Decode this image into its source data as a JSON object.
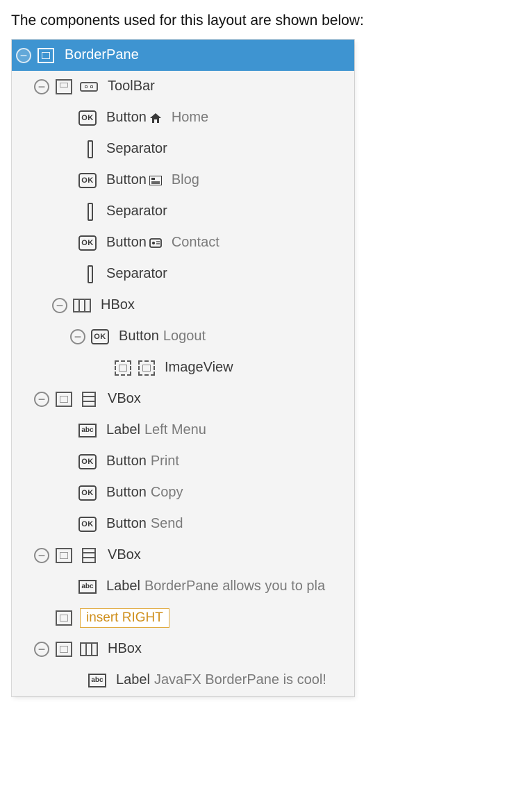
{
  "intro": "The components used for this layout are shown below:",
  "tree": {
    "root": "BorderPane",
    "toolbar": {
      "type": "ToolBar",
      "items": [
        {
          "type": "Button",
          "text": "Home",
          "glyph_name": "home-icon"
        },
        {
          "type": "Separator"
        },
        {
          "type": "Button",
          "text": "Blog",
          "glyph_name": "blog-icon"
        },
        {
          "type": "Separator"
        },
        {
          "type": "Button",
          "text": "Contact",
          "glyph_name": "contact-icon"
        },
        {
          "type": "Separator"
        },
        {
          "type": "HBox",
          "children": [
            {
              "type": "Button",
              "text": "Logout",
              "children": [
                {
                  "type": "ImageView"
                }
              ]
            }
          ]
        }
      ]
    },
    "left_vbox": {
      "type": "VBox",
      "children": [
        {
          "type": "Label",
          "text": "Left Menu"
        },
        {
          "type": "Button",
          "text": "Print"
        },
        {
          "type": "Button",
          "text": "Copy"
        },
        {
          "type": "Button",
          "text": "Send"
        }
      ]
    },
    "center_vbox": {
      "type": "VBox",
      "children": [
        {
          "type": "Label",
          "text": "BorderPane allows you to pla"
        }
      ]
    },
    "right_placeholder": "insert RIGHT",
    "bottom_hbox": {
      "type": "HBox",
      "children": [
        {
          "type": "Label",
          "text": "JavaFX BorderPane is cool!"
        }
      ]
    }
  },
  "labels": {
    "Button": "Button",
    "Separator": "Separator",
    "HBox": "HBox",
    "VBox": "VBox",
    "Label": "Label",
    "ImageView": "ImageView"
  }
}
